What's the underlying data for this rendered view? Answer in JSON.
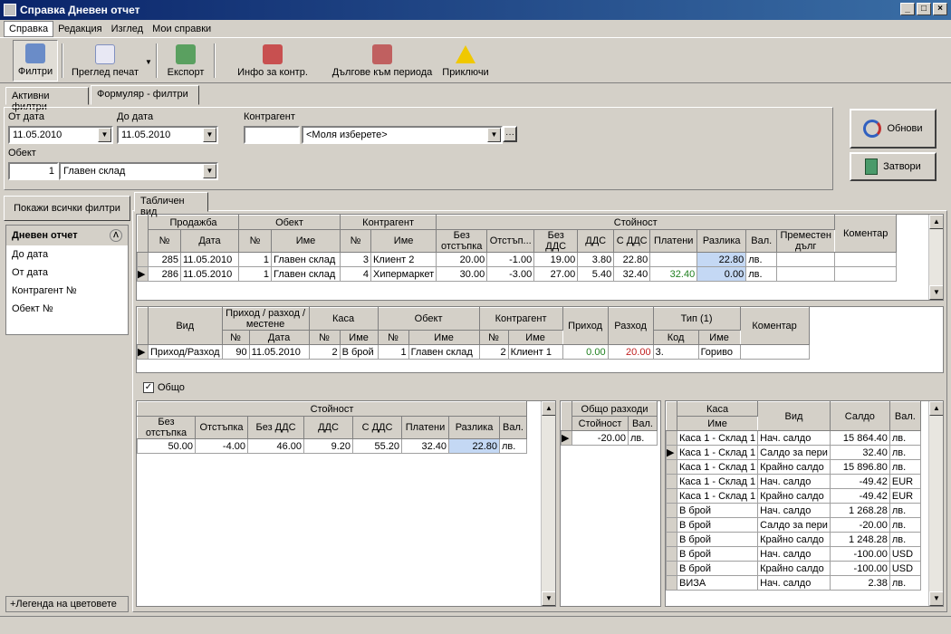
{
  "window": {
    "title": "Справка Дневен отчет"
  },
  "menu": [
    "Справка",
    "Редакция",
    "Изглед",
    "Мои справки"
  ],
  "toolbar": {
    "filters": "Филтри",
    "print_preview": "Преглед печат",
    "export": "Експорт",
    "info": "Инфо за контр.",
    "debts": "Дългове към периода",
    "finish": "Приключи"
  },
  "tabs": {
    "active_filters": "Активни филтри",
    "form_filters": "Формуляр - филтри",
    "table_view": "Табличен вид"
  },
  "form": {
    "from_label": "От дата",
    "from_value": "11.05.2010",
    "to_label": "До дата",
    "to_value": "11.05.2010",
    "partner_label": "Контрагент",
    "partner_value": "<Моля изберете>",
    "object_label": "Обект",
    "object_num": "1",
    "object_value": "Главен склад"
  },
  "buttons": {
    "refresh": "Обнови",
    "close": "Затвори"
  },
  "left": {
    "show_all": "Покажи всички филтри",
    "section": "Дневен отчет",
    "items": [
      "До дата",
      "От дата",
      "Контрагент №",
      "Обект №"
    ],
    "legend": "+Легенда на цветовете"
  },
  "sales": {
    "groups": [
      "Продажба",
      "Обект",
      "Контрагент",
      "Стойност"
    ],
    "cols": [
      "№",
      "Дата",
      "№",
      "Име",
      "№",
      "Име",
      "Без отстъпка",
      "Отстъп...",
      "Без ДДС",
      "ДДС",
      "С ДДС",
      "Платени",
      "Разлика",
      "Вал.",
      "Преместен дълг",
      "Коментар"
    ],
    "rows": [
      [
        "285",
        "11.05.2010",
        "1",
        "Главен склад",
        "3",
        "Клиент 2",
        "20.00",
        "-1.00",
        "19.00",
        "3.80",
        "22.80",
        "",
        "22.80",
        "лв.",
        "",
        ""
      ],
      [
        "286",
        "11.05.2010",
        "1",
        "Главен склад",
        "4",
        "Хипермаркет",
        "30.00",
        "-3.00",
        "27.00",
        "5.40",
        "32.40",
        "32.40",
        "0.00",
        "лв.",
        "",
        ""
      ]
    ]
  },
  "cash": {
    "groups": [
      "Вид",
      "Приход / разход / местене",
      "Каса",
      "Обект",
      "Контрагент",
      "Приход",
      "Разход",
      "Тип (1)",
      "Коментар"
    ],
    "cols": [
      "№",
      "Дата",
      "№",
      "Име",
      "№",
      "Име",
      "№",
      "Име",
      "Код",
      "Име"
    ],
    "rows": [
      [
        "Приход/Разход",
        "90",
        "11.05.2010",
        "2",
        "В брой",
        "1",
        "Главен склад",
        "2",
        "Клиент 1",
        "0.00",
        "20.00",
        "3.",
        "Гориво",
        ""
      ]
    ]
  },
  "total": {
    "label": "Общо",
    "checked": "✓"
  },
  "summary": {
    "group": "Стойност",
    "cols": [
      "Без отстъпка",
      "Отстъпка",
      "Без ДДС",
      "ДДС",
      "С ДДС",
      "Платени",
      "Разлика",
      "Вал."
    ],
    "row": [
      "50.00",
      "-4.00",
      "46.00",
      "9.20",
      "55.20",
      "32.40",
      "22.80",
      "лв."
    ]
  },
  "expenses": {
    "group": "Общо разходи",
    "cols": [
      "Стойност",
      "Вал."
    ],
    "row": [
      "-20.00",
      "лв."
    ]
  },
  "balance": {
    "group": "Каса",
    "cols": [
      "Име",
      "Вид",
      "Салдо",
      "Вал."
    ],
    "rows": [
      [
        "Каса 1 - Склад 1",
        "Нач. салдо",
        "15 864.40",
        "лв."
      ],
      [
        "Каса 1 - Склад 1",
        "Салдо за пери",
        "32.40",
        "лв."
      ],
      [
        "Каса 1 - Склад 1",
        "Крайно салдо",
        "15 896.80",
        "лв."
      ],
      [
        "Каса 1 - Склад 1",
        "Нач. салдо",
        "-49.42",
        "EUR"
      ],
      [
        "Каса 1 - Склад 1",
        "Крайно салдо",
        "-49.42",
        "EUR"
      ],
      [
        "В брой",
        "Нач. салдо",
        "1 268.28",
        "лв."
      ],
      [
        "В брой",
        "Салдо за пери",
        "-20.00",
        "лв."
      ],
      [
        "В брой",
        "Крайно салдо",
        "1 248.28",
        "лв."
      ],
      [
        "В брой",
        "Нач. салдо",
        "-100.00",
        "USD"
      ],
      [
        "В брой",
        "Крайно салдо",
        "-100.00",
        "USD"
      ],
      [
        "ВИЗА",
        "Нач. салдо",
        "2.38",
        "лв."
      ]
    ]
  }
}
